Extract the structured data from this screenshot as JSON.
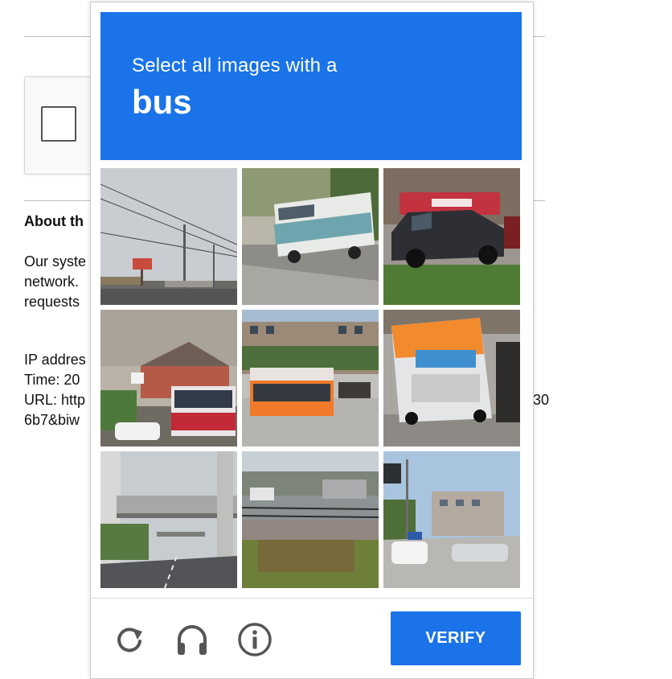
{
  "background": {
    "about_heading": "About th",
    "para_lines": [
      "Our syste",
      "network.",
      "requests"
    ],
    "info_lines": [
      "IP addres",
      "Time: 20",
      "URL: http",
      "6b7&biw"
    ],
    "url_tail": "30"
  },
  "challenge": {
    "instruction": "Select all images with a",
    "target": "bus",
    "accent_color": "#1a73e8",
    "tiles": [
      {
        "id": 1,
        "scene": "street with power lines and CVS sign"
      },
      {
        "id": 2,
        "scene": "white RV bus on road"
      },
      {
        "id": 3,
        "scene": "dark sedan in front of minimax store"
      },
      {
        "id": 4,
        "scene": "red and white bus near houses"
      },
      {
        "id": 5,
        "scene": "orange bus at intersection"
      },
      {
        "id": 6,
        "scene": "orange and white bus rear view"
      },
      {
        "id": 7,
        "scene": "overpass above empty road"
      },
      {
        "id": 8,
        "scene": "cars near waterfront fence"
      },
      {
        "id": 9,
        "scene": "street with cars and buildings"
      }
    ],
    "footer": {
      "reload_icon": "reload-icon",
      "audio_icon": "headphones-icon",
      "info_icon": "info-icon",
      "verify_label": "VERIFY"
    }
  }
}
